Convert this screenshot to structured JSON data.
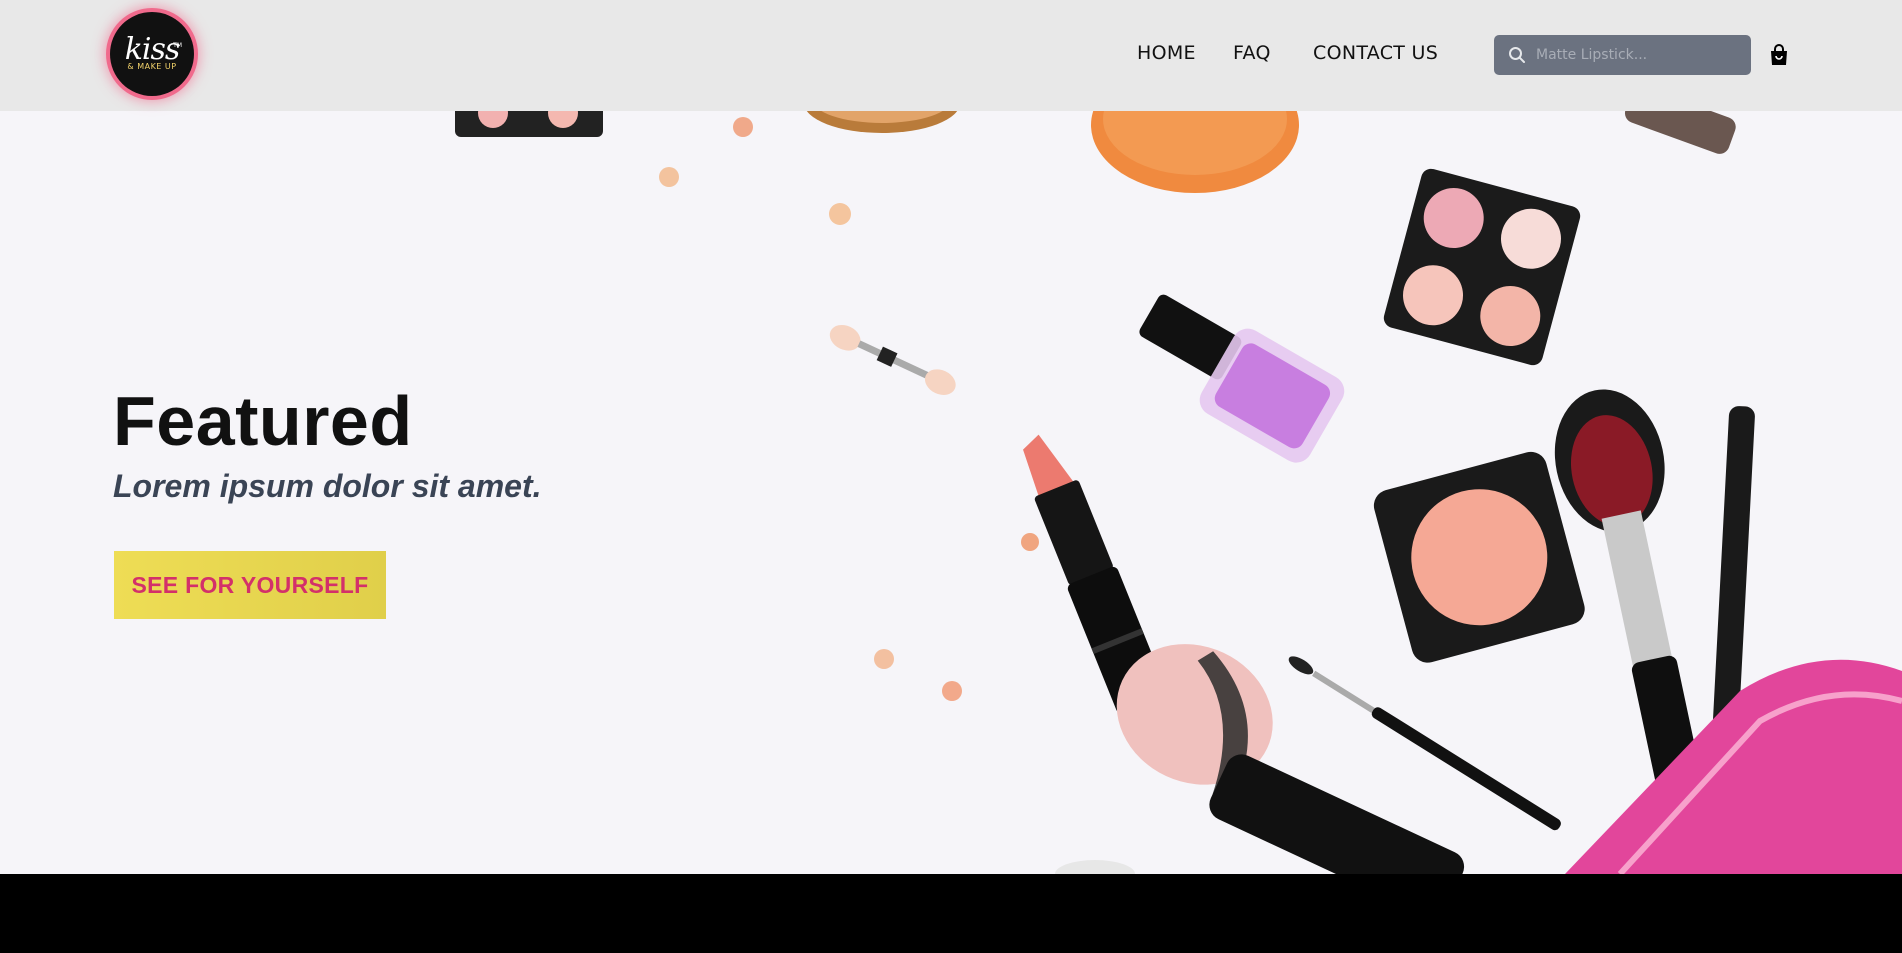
{
  "header": {
    "logo": {
      "script": "kiss",
      "sub": "& MAKE UP",
      "tm": "TM"
    },
    "nav": {
      "home": "HOME",
      "faq": "FAQ",
      "contact": "CONTACT US"
    },
    "search": {
      "placeholder": "Matte Lipstick...",
      "icon": "search-icon"
    },
    "cart_icon": "shopping-bag-icon"
  },
  "hero": {
    "title": "Featured",
    "subtitle": "Lorem ipsum dolor sit amet.",
    "cta_label": "SEE FOR YOURSELF"
  },
  "colors": {
    "header_bg": "#e8e8e8",
    "search_bg": "#6b7280",
    "cta_bg": "#eedd55",
    "cta_text": "#d3306a",
    "accent_pink": "#f06a8c"
  }
}
